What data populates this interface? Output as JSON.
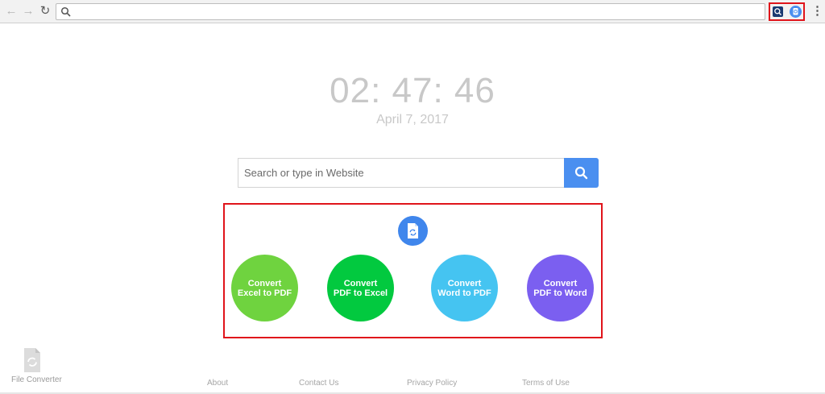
{
  "browser": {
    "address_value": "",
    "icons": {
      "back": "back-arrow-icon",
      "forward": "forward-arrow-icon",
      "reload": "reload-icon",
      "omnibox": "search-icon",
      "extension_1": "search-extension-icon",
      "extension_2": "file-converter-extension-icon",
      "menu": "kebab-menu-icon"
    }
  },
  "clock": {
    "time": "02: 47: 46",
    "date": "April 7, 2017"
  },
  "search": {
    "placeholder": "Search or type in Website"
  },
  "converters": [
    {
      "line1": "Convert",
      "line2": "Excel to PDF",
      "color": "#6fd33f"
    },
    {
      "line1": "Convert",
      "line2": "PDF to Excel",
      "color": "#02c93f"
    },
    {
      "line1": "Convert",
      "line2": "Word to PDF",
      "color": "#45c4f1"
    },
    {
      "line1": "Convert",
      "line2": "PDF to Word",
      "color": "#7b5ff0"
    }
  ],
  "branding": {
    "label": "File Converter"
  },
  "footer": {
    "links": [
      "About",
      "Contact Us",
      "Privacy Policy",
      "Terms of Use"
    ]
  },
  "colors": {
    "accent": "#4a8ff0",
    "highlight": "#e0141b"
  }
}
